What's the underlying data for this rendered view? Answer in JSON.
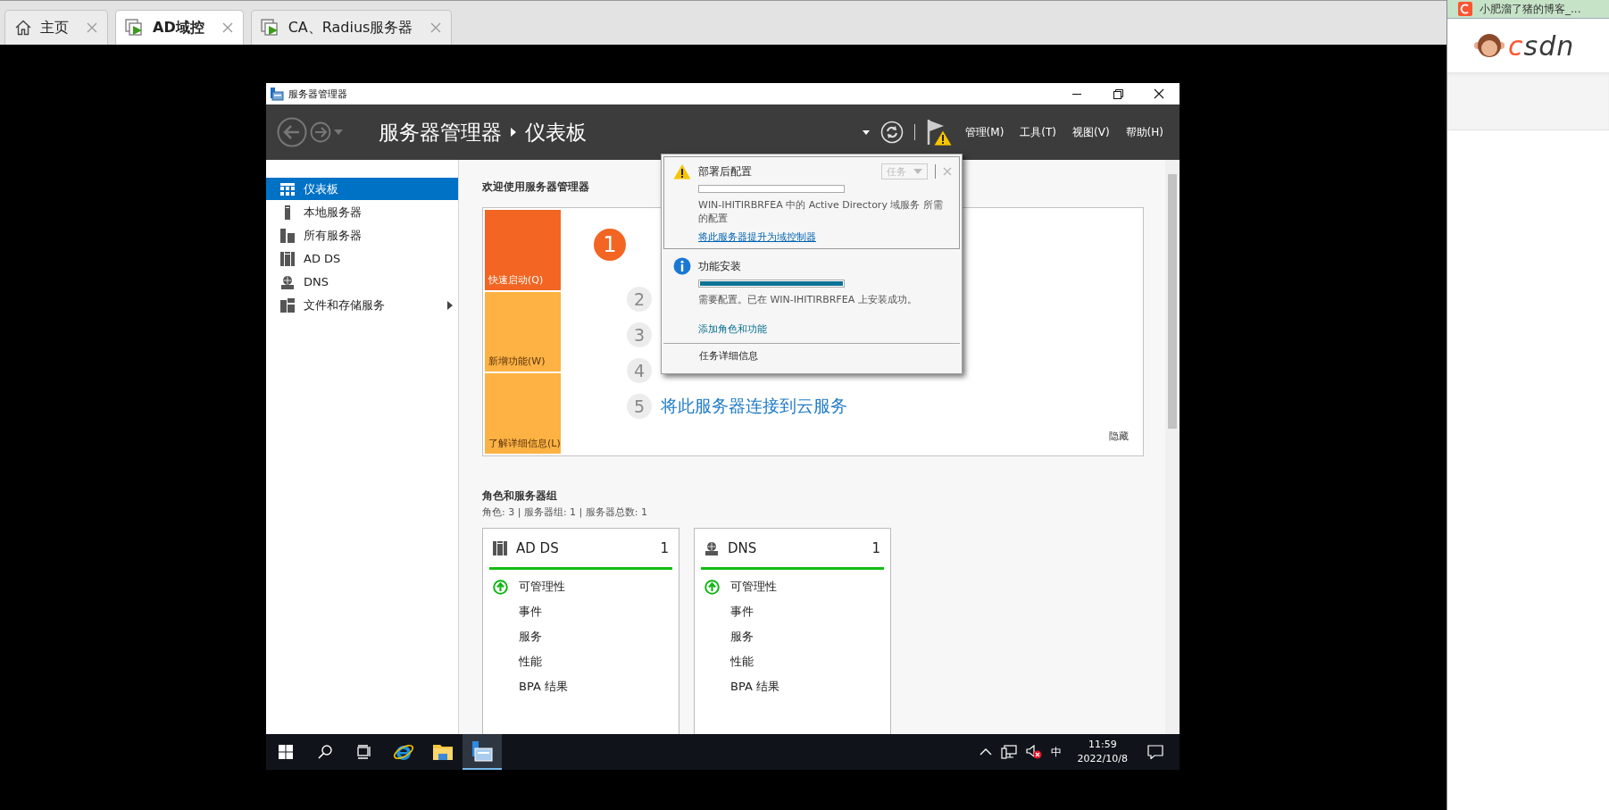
{
  "browser_tabs": [
    {
      "label": "主页",
      "kind": "home",
      "selected": false
    },
    {
      "label": "AD域控",
      "kind": "vm",
      "selected": true
    },
    {
      "label": "CA、Radius服务器",
      "kind": "vm",
      "selected": false
    }
  ],
  "side_panel": {
    "top_tab_title": "小肥溜了猪的博客_...",
    "logo": "csdn"
  },
  "vm_window": {
    "title": "服务器管理器",
    "header": {
      "breadcrumb": [
        "服务器管理器",
        "仪表板"
      ],
      "menus": [
        "管理(M)",
        "工具(T)",
        "视图(V)",
        "帮助(H)"
      ]
    },
    "sidebar": {
      "items": [
        {
          "label": "仪表板",
          "selected": true,
          "expandable": false
        },
        {
          "label": "本地服务器",
          "selected": false,
          "expandable": false
        },
        {
          "label": "所有服务器",
          "selected": false,
          "expandable": false
        },
        {
          "label": "AD DS",
          "selected": false,
          "expandable": false
        },
        {
          "label": "DNS",
          "selected": false,
          "expandable": false
        },
        {
          "label": "文件和存储服务",
          "selected": false,
          "expandable": true
        }
      ]
    },
    "welcome": {
      "title": "欢迎使用服务器管理器",
      "tiles": [
        {
          "label": "快速启动(Q)",
          "selected": true
        },
        {
          "label": "新增功能(W)",
          "selected": false
        },
        {
          "label": "了解详细信息(L)",
          "selected": false
        }
      ],
      "steps": [
        {
          "number": "1",
          "selected": true
        },
        {
          "number": "2",
          "selected": false
        },
        {
          "number": "3",
          "selected": false
        },
        {
          "number": "4",
          "selected": false
        },
        {
          "number": "5",
          "selected": false,
          "label": "将此服务器连接到云服务"
        }
      ],
      "hide_link": "隐藏"
    },
    "roles": {
      "title": "角色和服务器组",
      "summary": "角色: 3 | 服务器组: 1 | 服务器总数: 1",
      "cards": [
        {
          "name": "AD DS",
          "count": "1",
          "rows": [
            {
              "label": "可管理性",
              "healthy": true
            },
            {
              "label": "事件",
              "healthy": false
            },
            {
              "label": "服务",
              "healthy": false
            },
            {
              "label": "性能",
              "healthy": false
            },
            {
              "label": "BPA 结果",
              "healthy": false
            }
          ]
        },
        {
          "name": "DNS",
          "count": "1",
          "rows": [
            {
              "label": "可管理性",
              "healthy": true
            },
            {
              "label": "事件",
              "healthy": false
            },
            {
              "label": "服务",
              "healthy": false
            },
            {
              "label": "性能",
              "healthy": false
            },
            {
              "label": "BPA 结果",
              "healthy": false
            }
          ]
        }
      ]
    },
    "notifications": {
      "items": [
        {
          "kind": "warning",
          "title": "部署后配置",
          "selected": true,
          "task_button": {
            "label": "任务",
            "disabled": true
          },
          "level": 0,
          "message": "WIN-IHITIRBRFEA 中的 Active Directory 域服务 所需的配置",
          "link": "将此服务器提升为域控制器"
        },
        {
          "kind": "info",
          "title": "功能安装",
          "selected": false,
          "level": 1,
          "message": "需要配置。已在 WIN-IHITIRBRFEA 上安装成功。",
          "link": "添加角色和功能"
        }
      ],
      "footer": "任务详细信息"
    },
    "taskbar": {
      "apps": [
        {
          "selected": false
        },
        {
          "selected": false
        },
        {
          "selected": false
        },
        {
          "selected": false
        },
        {
          "selected": false
        },
        {
          "selected": true
        }
      ],
      "tray": {
        "ime": "中",
        "time": "11:59",
        "date": "2022/10/8"
      }
    }
  }
}
